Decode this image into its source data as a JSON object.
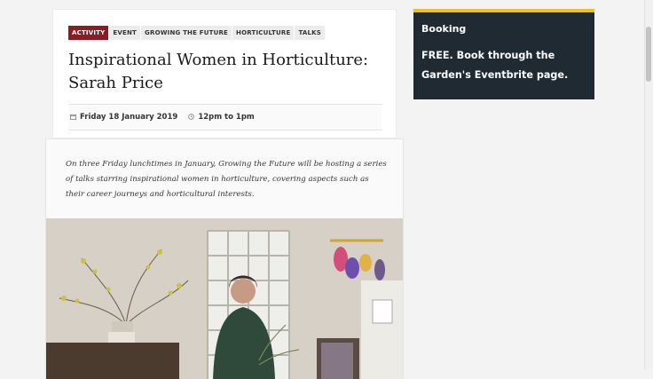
{
  "event": {
    "tags": [
      {
        "label": "ACTIVITY",
        "active": true
      },
      {
        "label": "EVENT",
        "active": false
      },
      {
        "label": "GROWING THE FUTURE",
        "active": false
      },
      {
        "label": "HORTICULTURE",
        "active": false
      },
      {
        "label": "TALKS",
        "active": false
      }
    ],
    "title": "Inspirational Women in Horticulture: Sarah Price",
    "date": "Friday 18 January 2019",
    "time": "12pm to 1pm",
    "calendar_icon": "calendar-icon",
    "clock_icon": "clock-icon"
  },
  "content": {
    "intro": "On three Friday lunchtimes in January, Growing the Future will be hosting a series of talks starring inspirational women in horticulture, covering aspects such as their career journeys and horticultural interests."
  },
  "booking": {
    "heading": "Booking",
    "text": "FREE. Book through the Garden's Eventbrite page."
  },
  "colors": {
    "accent": "#8b1c24",
    "booking_bg": "#1f2a33",
    "booking_bar": "#f2c01a"
  }
}
